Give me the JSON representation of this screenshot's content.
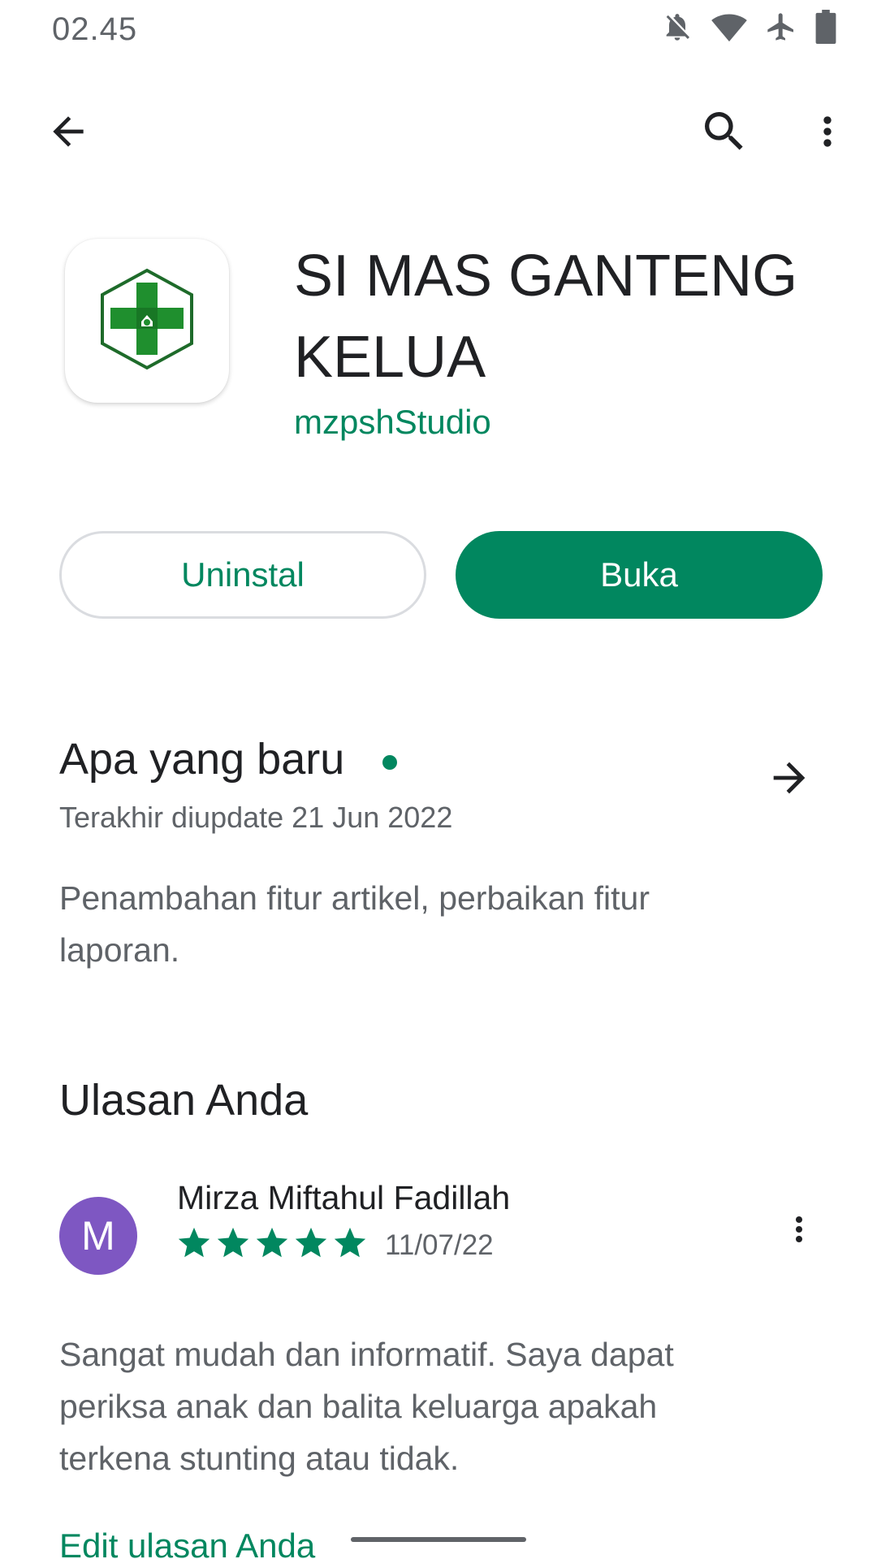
{
  "status_bar": {
    "time": "02.45",
    "icons": [
      "notifications-off-icon",
      "wifi-icon",
      "airplane-icon",
      "battery-icon"
    ]
  },
  "app_bar": {
    "icons": [
      "back-arrow-icon",
      "search-icon",
      "more-vert-icon"
    ]
  },
  "app": {
    "title": "SI MAS GANTENG KELUA",
    "developer": "mzpshStudio",
    "icon": "health-cross-hexagon-icon"
  },
  "actions": {
    "uninstall_label": "Uninstal",
    "open_label": "Buka"
  },
  "whats_new": {
    "title": "Apa yang baru",
    "updated": "Terakhir diupdate 21 Jun 2022",
    "body": "Penambahan fitur artikel, perbaikan fitur laporan."
  },
  "your_review": {
    "title": "Ulasan Anda",
    "avatar_letter": "M",
    "reviewer": "Mirza Miftahul Fadillah",
    "rating": 5,
    "rating_max": 5,
    "date": "11/07/22",
    "text": "Sangat mudah dan informatif. Saya dapat periksa anak dan balita keluarga apakah terkena stunting atau tidak.",
    "edit_label": "Edit ulasan Anda"
  },
  "colors": {
    "accent": "#01875f",
    "avatar": "#7e57c2",
    "text_primary": "#202124",
    "text_secondary": "#5f6368"
  }
}
